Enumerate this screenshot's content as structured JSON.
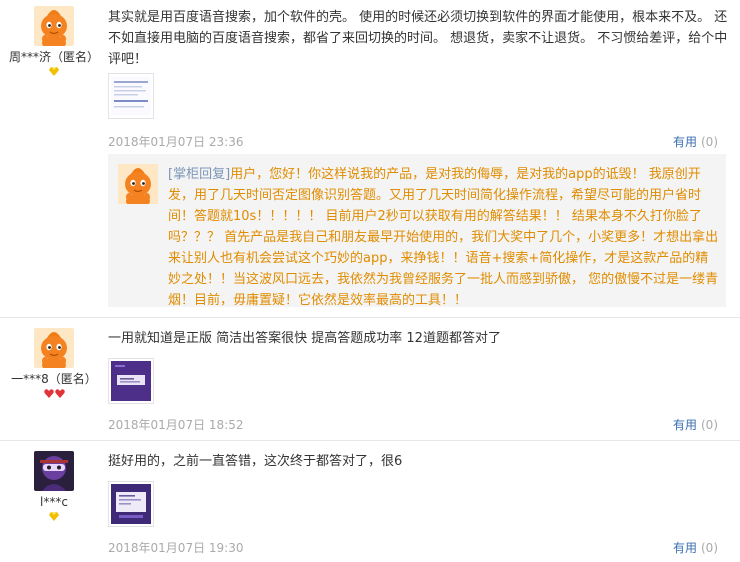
{
  "reviews": [
    {
      "user": "周***济（匿名）",
      "text": "其实就是用百度语音搜索，加个软件的壳。 使用的时候还必须切换到软件的界面才能使用，根本来不及。 还不如直接用电脑的百度语音搜索，都省了来回切换的时间。 想退货，卖家不让退货。 不习惯给差评，给个中评吧！",
      "date": "2018年01月07日 23:36",
      "useful_label": "有用",
      "useful_count": "(0)",
      "reply": {
        "tag": "[掌柜回复]",
        "text": "用户，您好！你这样说我的产品，是对我的侮辱，是对我的app的诋毁！ 我原创开发，用了几天时间否定图像识别答题。又用了几天时间简化操作流程，希望尽可能的用户省时间！答题就10s！！！！！ 目前用户2秒可以获取有用的解答结果！！ 结果本身不久打你脸了吗？？？ 首先产品是我自己和朋友最早开始使用的，我们大奖中了几个，小奖更多！才想出拿出来让别人也有机会尝试这个巧妙的app，来挣钱！！语音+搜索+简化操作，才是这款产品的精妙之处！！当这波风口远去，我依然为我曾经服务了一批人而感到骄傲， 您的傲慢不过是一缕青烟！目前，毋庸置疑！它依然是效率最高的工具！！"
      }
    },
    {
      "user": "一***8（匿名）",
      "text": "一用就知道是正版 简洁出答案很快 提高答题成功率 12道题都答对了",
      "date": "2018年01月07日 18:52",
      "useful_label": "有用",
      "useful_count": "(0)"
    },
    {
      "user": "l***c",
      "text": "挺好用的，之前一直答错，这次终于都答对了，很6",
      "date": "2018年01月07日 19:30",
      "useful_label": "有用",
      "useful_count": "(0)"
    }
  ],
  "colors": {
    "useful_link": "#3a6fb0",
    "reply_text": "#e08c00",
    "reply_tag": "#7b96b8",
    "date": "#aaaaaa",
    "reply_bg": "#f4f4f4"
  }
}
